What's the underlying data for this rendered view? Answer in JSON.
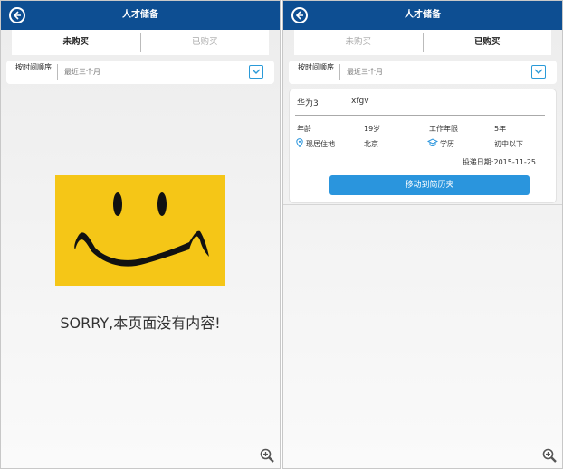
{
  "left": {
    "title": "人才储备",
    "tabs": [
      "未购买",
      "已购买"
    ],
    "active_tab": 0,
    "filter": {
      "label": "按时间顺序",
      "value": "最近三个月"
    },
    "empty_message": "SORRY,本页面没有内容!"
  },
  "right": {
    "title": "人才储备",
    "tabs": [
      "未购买",
      "已购买"
    ],
    "active_tab": 1,
    "filter": {
      "label": "按时间顺序",
      "value": "最近三个月"
    },
    "candidate": {
      "name": "华为3",
      "code": "xfgv",
      "age_label": "年龄",
      "age": "19岁",
      "experience_label": "工作年限",
      "experience": "5年",
      "residence_label": "现居住地",
      "residence": "北京",
      "education_label": "学历",
      "education": "初中以下",
      "submit_date": "投递日期:2015-11-25",
      "move_button": "移动到简历夹"
    }
  },
  "colors": {
    "header": "#0d4e92",
    "accent": "#2a95dd",
    "smiley": "#f5c617"
  }
}
